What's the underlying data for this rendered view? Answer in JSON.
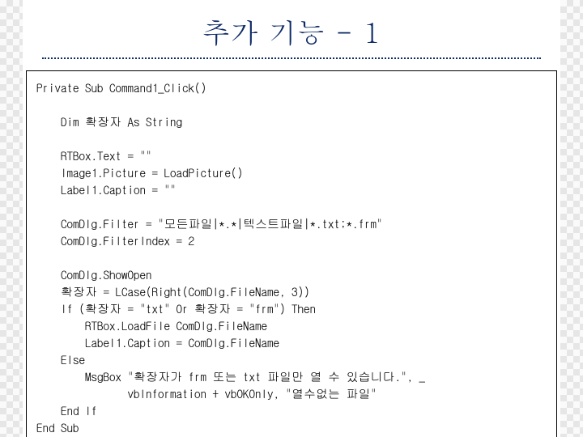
{
  "title": "추가 기능 - 1",
  "code": "Private Sub Command1_Click()\n\n    Dim 확장자 As String\n\n    RTBox.Text = \"\"\n    Image1.Picture = LoadPicture()\n    Label1.Caption = \"\"\n\n    ComDlg.Filter = \"모든파일|*.*|텍스트파일|*.txt;*.frm\"\n    ComDlg.FilterIndex = 2\n\n    ComDlg.ShowOpen\n    확장자 = LCase(Right(ComDlg.FileName, 3))\n    If (확장자 = \"txt\" Or 확장자 = \"frm\") Then\n        RTBox.LoadFile ComDlg.FileName\n        Label1.Caption = ComDlg.FileName\n    Else\n        MsgBox \"확장자가 frm 또는 txt 파일만 열 수 있습니다.\", _\n               vbInformation + vbOKOnly, \"열수없는 파일\"\n    End If\nEnd Sub"
}
